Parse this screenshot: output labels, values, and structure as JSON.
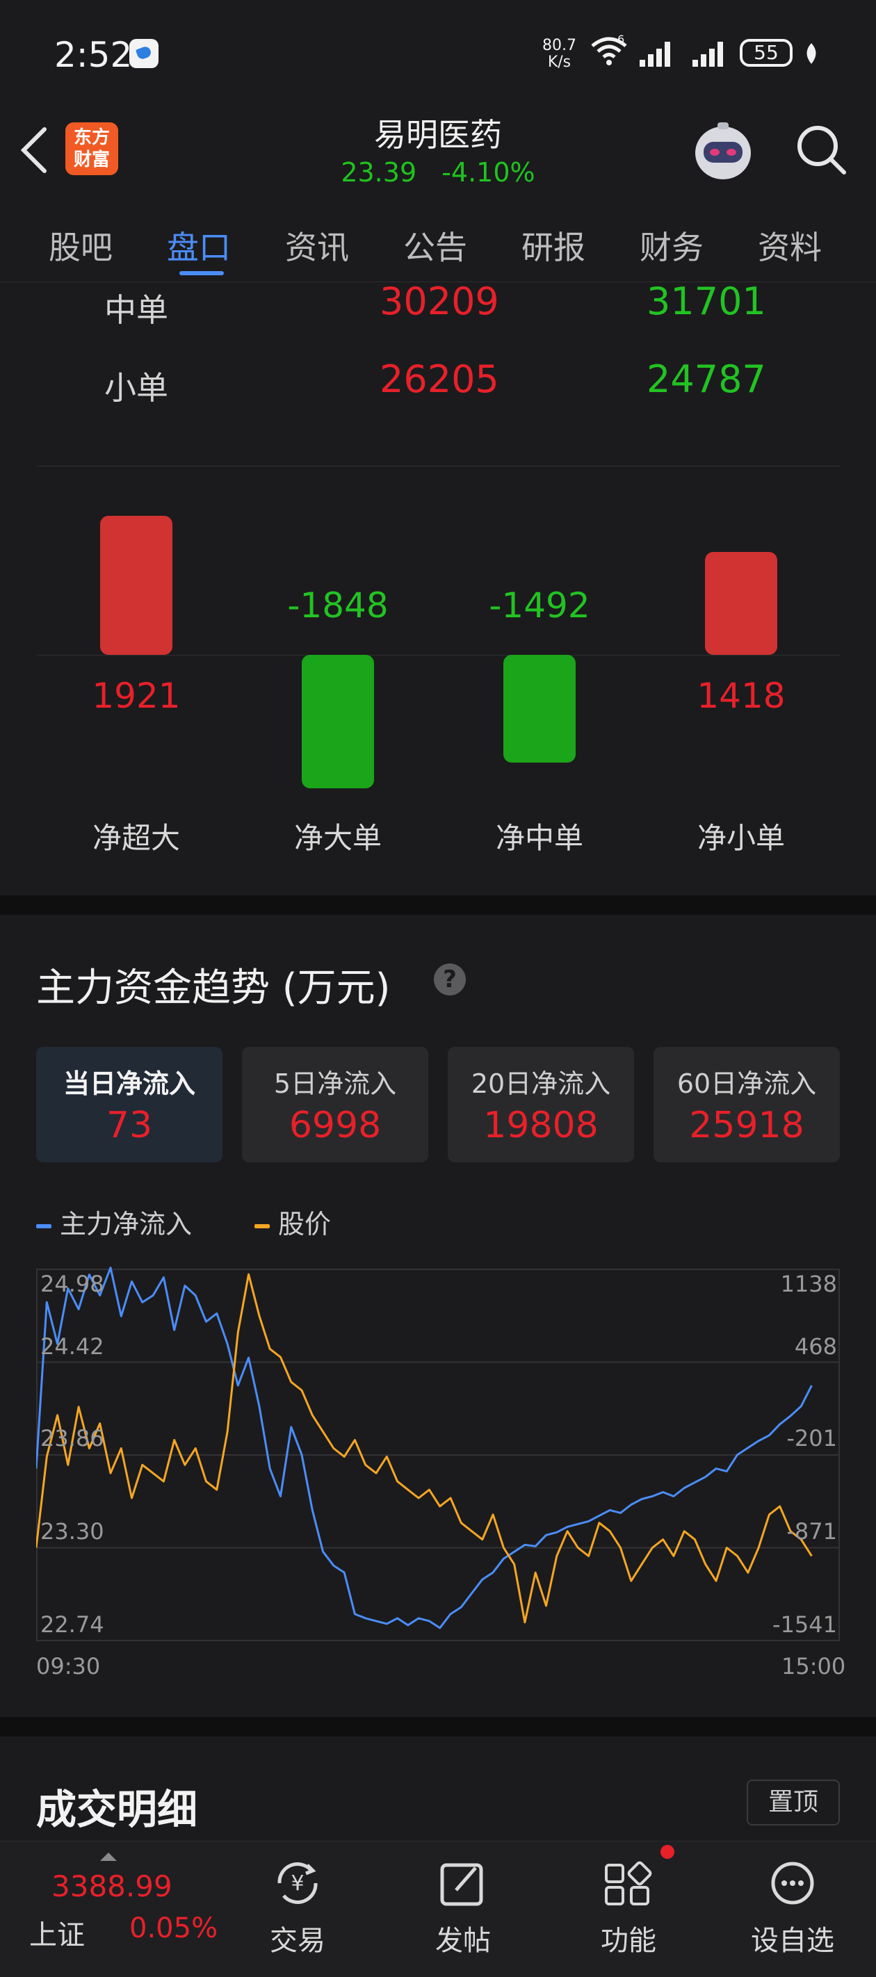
{
  "status_bar": {
    "time": "2:52",
    "net_speed_value": "80.7",
    "net_speed_unit": "K/s",
    "network_type": "6",
    "battery": "55"
  },
  "header": {
    "app_logo_line1": "东方",
    "app_logo_line2": "财富",
    "stock_name": "易明医药",
    "price": "23.39",
    "change_pct": "-4.10%"
  },
  "tabs": [
    "股吧",
    "盘口",
    "资讯",
    "公告",
    "研报",
    "财务",
    "资料"
  ],
  "active_tab": "盘口",
  "orders": [
    {
      "label": "中单",
      "buy": "30209",
      "sell": "31701"
    },
    {
      "label": "小单",
      "buy": "26205",
      "sell": "24787"
    }
  ],
  "net_bars": [
    {
      "label": "净超大",
      "value": 1921,
      "display": "1921"
    },
    {
      "label": "净大单",
      "value": -1848,
      "display": "-1848"
    },
    {
      "label": "净中单",
      "value": -1492,
      "display": "-1492"
    },
    {
      "label": "净小单",
      "value": 1418,
      "display": "1418"
    }
  ],
  "trend": {
    "title": "主力资金趋势 (万元)",
    "help": "?",
    "cards": [
      {
        "label": "当日净流入",
        "value": "73"
      },
      {
        "label": "5日净流入",
        "value": "6998"
      },
      {
        "label": "20日净流入",
        "value": "19808"
      },
      {
        "label": "60日净流入",
        "value": "25918"
      }
    ],
    "legend": [
      {
        "name": "主力净流入",
        "color": "#4b8df8"
      },
      {
        "name": "股价",
        "color": "#f5a623"
      }
    ]
  },
  "chart_data": {
    "type": "line",
    "x_start": "09:30",
    "x_end": "15:00",
    "left_axis_ticks": [
      "24.98",
      "24.42",
      "23.86",
      "23.30",
      "22.74"
    ],
    "right_axis_ticks": [
      "1138",
      "468",
      "-201",
      "-871",
      "-1541"
    ],
    "price_range": [
      22.74,
      24.98
    ],
    "flow_range": [
      -1541,
      1138
    ],
    "series": [
      {
        "name": "主力净流入",
        "axis": "right",
        "values": [
          -300,
          900,
          600,
          1000,
          850,
          1100,
          950,
          1150,
          800,
          1050,
          900,
          950,
          1080,
          700,
          1020,
          950,
          760,
          820,
          600,
          300,
          500,
          150,
          -300,
          -500,
          0,
          -200,
          -600,
          -900,
          -1000,
          -1050,
          -1350,
          -1380,
          -1400,
          -1420,
          -1380,
          -1430,
          -1380,
          -1400,
          -1450,
          -1350,
          -1300,
          -1200,
          -1100,
          -1050,
          -950,
          -900,
          -850,
          -860,
          -780,
          -760,
          -720,
          -700,
          -680,
          -640,
          -600,
          -620,
          -560,
          -520,
          -500,
          -470,
          -500,
          -440,
          -400,
          -360,
          -300,
          -320,
          -200,
          -150,
          -100,
          -60,
          20,
          80,
          150,
          300
        ]
      },
      {
        "name": "股价",
        "axis": "left",
        "values": [
          23.3,
          23.85,
          24.1,
          23.8,
          24.15,
          23.9,
          24.05,
          23.75,
          23.9,
          23.6,
          23.8,
          23.75,
          23.7,
          23.95,
          23.8,
          23.9,
          23.7,
          23.65,
          24.0,
          24.6,
          24.95,
          24.7,
          24.5,
          24.45,
          24.3,
          24.25,
          24.1,
          24.0,
          23.9,
          23.85,
          23.95,
          23.8,
          23.75,
          23.85,
          23.7,
          23.65,
          23.6,
          23.65,
          23.55,
          23.6,
          23.45,
          23.4,
          23.35,
          23.5,
          23.3,
          23.2,
          22.85,
          23.15,
          22.95,
          23.25,
          23.4,
          23.3,
          23.25,
          23.45,
          23.4,
          23.3,
          23.1,
          23.2,
          23.3,
          23.35,
          23.25,
          23.4,
          23.35,
          23.2,
          23.1,
          23.3,
          23.25,
          23.15,
          23.3,
          23.5,
          23.55,
          23.4,
          23.35,
          23.25
        ]
      }
    ]
  },
  "detail": {
    "title": "成交明细",
    "pin_label": "置顶"
  },
  "bottom_nav": {
    "index_value": "3388.99",
    "index_name": "上证",
    "index_pct": "0.05%",
    "items": [
      "交易",
      "发帖",
      "功能",
      "设自选"
    ]
  }
}
